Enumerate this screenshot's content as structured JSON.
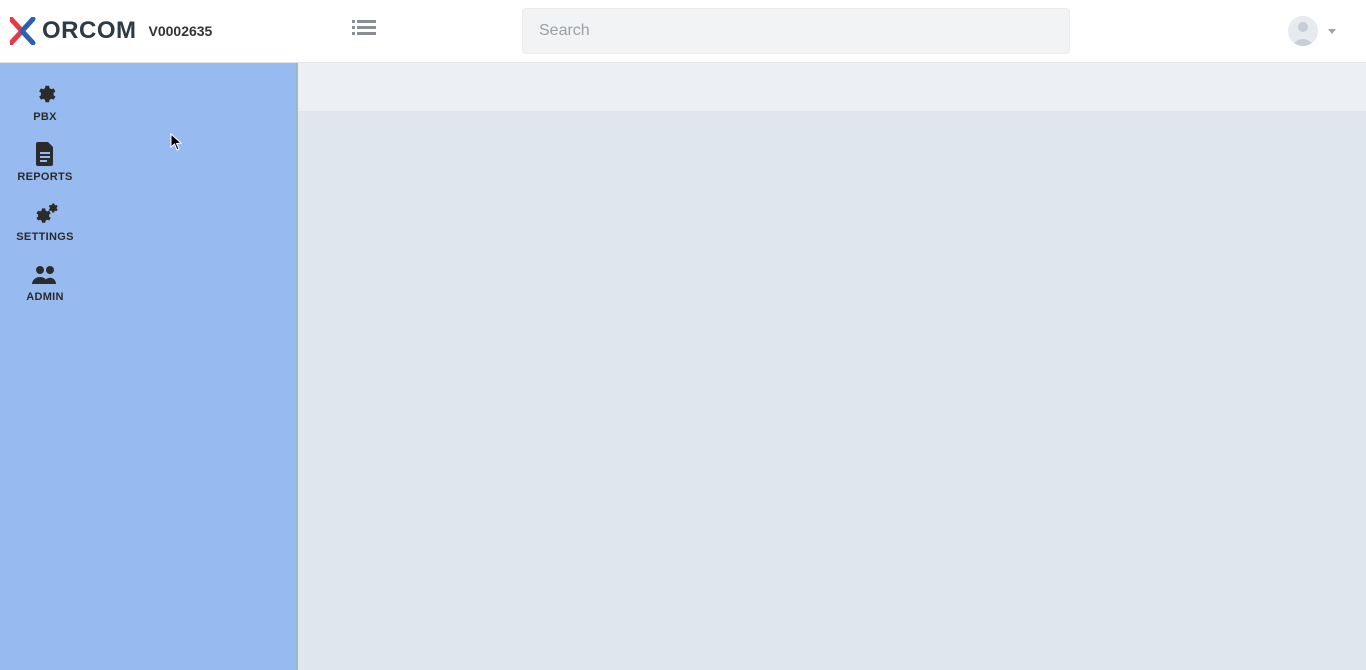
{
  "header": {
    "brand": "ORCOM",
    "version": "V0002635"
  },
  "search": {
    "placeholder": "Search"
  },
  "sidebar": {
    "items": [
      {
        "label": "PBX",
        "icon": "gear-icon"
      },
      {
        "label": "REPORTS",
        "icon": "document-icon"
      },
      {
        "label": "SETTINGS",
        "icon": "gears-icon"
      },
      {
        "label": "ADMIN",
        "icon": "users-icon"
      }
    ]
  }
}
